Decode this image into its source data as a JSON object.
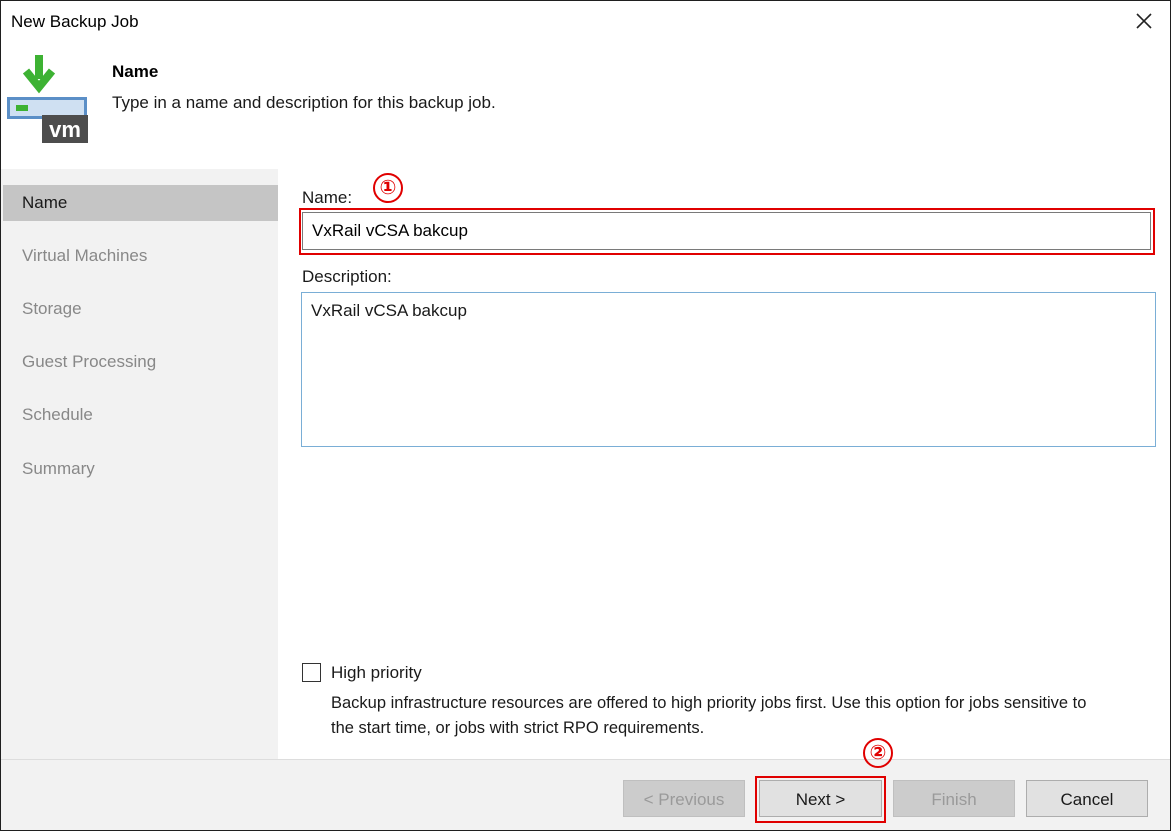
{
  "window": {
    "title": "New Backup Job"
  },
  "header": {
    "title": "Name",
    "subtitle": "Type in a name and description for this backup job.",
    "icon_text": "vm",
    "icon": "vm-backup-icon"
  },
  "sidebar": {
    "items": [
      {
        "label": "Name",
        "active": true
      },
      {
        "label": "Virtual Machines"
      },
      {
        "label": "Storage"
      },
      {
        "label": "Guest Processing"
      },
      {
        "label": "Schedule"
      },
      {
        "label": "Summary"
      }
    ]
  },
  "form": {
    "name_label": "Name:",
    "name_value": "VxRail vCSA bakcup",
    "description_label": "Description:",
    "description_value": "VxRail vCSA bakcup",
    "high_priority_label": "High priority",
    "high_priority_checked": false,
    "high_priority_desc": "Backup infrastructure resources are offered to high priority jobs first. Use this option for jobs sensitive to the start time, or jobs with strict RPO requirements."
  },
  "annotations": {
    "step1": "①",
    "step2": "②",
    "color": "#e00000"
  },
  "buttons": {
    "previous": "< Previous",
    "next": "Next >",
    "finish": "Finish",
    "cancel": "Cancel"
  }
}
